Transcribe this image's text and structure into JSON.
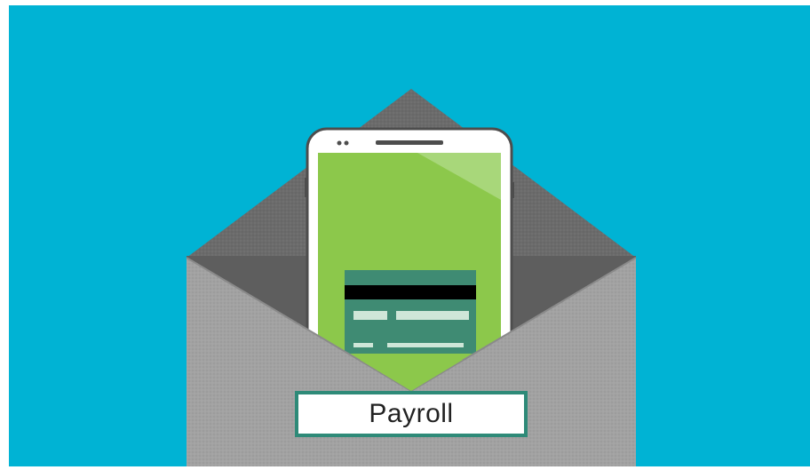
{
  "illustration": {
    "label": "Payroll",
    "colors": {
      "background": "#00b3d4",
      "envelope_light": "#a2a2a2",
      "envelope_dark": "#6b6b6b",
      "phone_frame": "#ffffff",
      "phone_screen": "#8cc84b",
      "card": "#3f8b73",
      "card_stripe": "#000000",
      "label_border": "#2e8a78"
    },
    "icons": [
      "envelope-icon",
      "smartphone-icon",
      "credit-card-icon"
    ]
  }
}
